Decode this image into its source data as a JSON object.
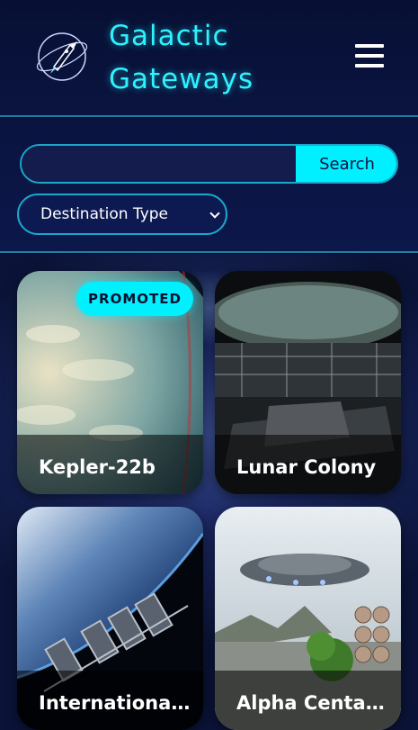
{
  "header": {
    "title_line1": "Galactic",
    "title_line2": "Gateways",
    "logo_icon": "rocket-planet-icon",
    "menu_icon": "hamburger-menu-icon"
  },
  "search": {
    "input_value": "",
    "input_placeholder": "",
    "button_label": "Search"
  },
  "filter": {
    "selected": "Destination Type"
  },
  "destinations": [
    {
      "name": "Kepler-22b",
      "promoted": true,
      "badge": "PROMOTED"
    },
    {
      "name": "Lunar Colony",
      "promoted": false
    },
    {
      "name": "International Space Station",
      "promoted": false
    },
    {
      "name": "Alpha Centauri",
      "promoted": false
    }
  ],
  "colors": {
    "accent": "#00f0ff",
    "title": "#2ef2ff",
    "background": "#0a1440",
    "border": "#1f7fa0"
  }
}
